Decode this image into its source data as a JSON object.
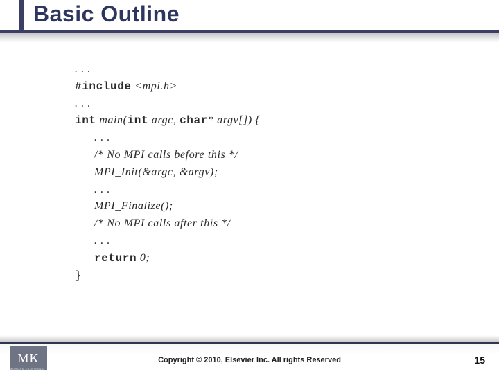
{
  "title": "Basic Outline",
  "code": {
    "l0": ". . .",
    "l1a": "#include",
    "l1b": " <mpi.h>",
    "l2": ". . .",
    "l3a": "int",
    "l3b": " main(",
    "l3c": "int",
    "l3d": " argc, ",
    "l3e": "char",
    "l3f": "* argv[]) {",
    "l4": ". . .",
    "l5": "/* No MPI calls before this */",
    "l6": "MPI_Init(&argc, &argv);",
    "l7": ". . .",
    "l8": "MPI_Finalize();",
    "l9": "/* No MPI calls after this */",
    "l10": ". . .",
    "l11a": "return",
    "l11b": " 0;",
    "l12": "}"
  },
  "footer": {
    "logo_text": "MK",
    "logo_sub": "MORGAN KAUFMANN",
    "copyright": "Copyright © 2010, Elsevier Inc. All rights Reserved",
    "page_number": "15"
  }
}
